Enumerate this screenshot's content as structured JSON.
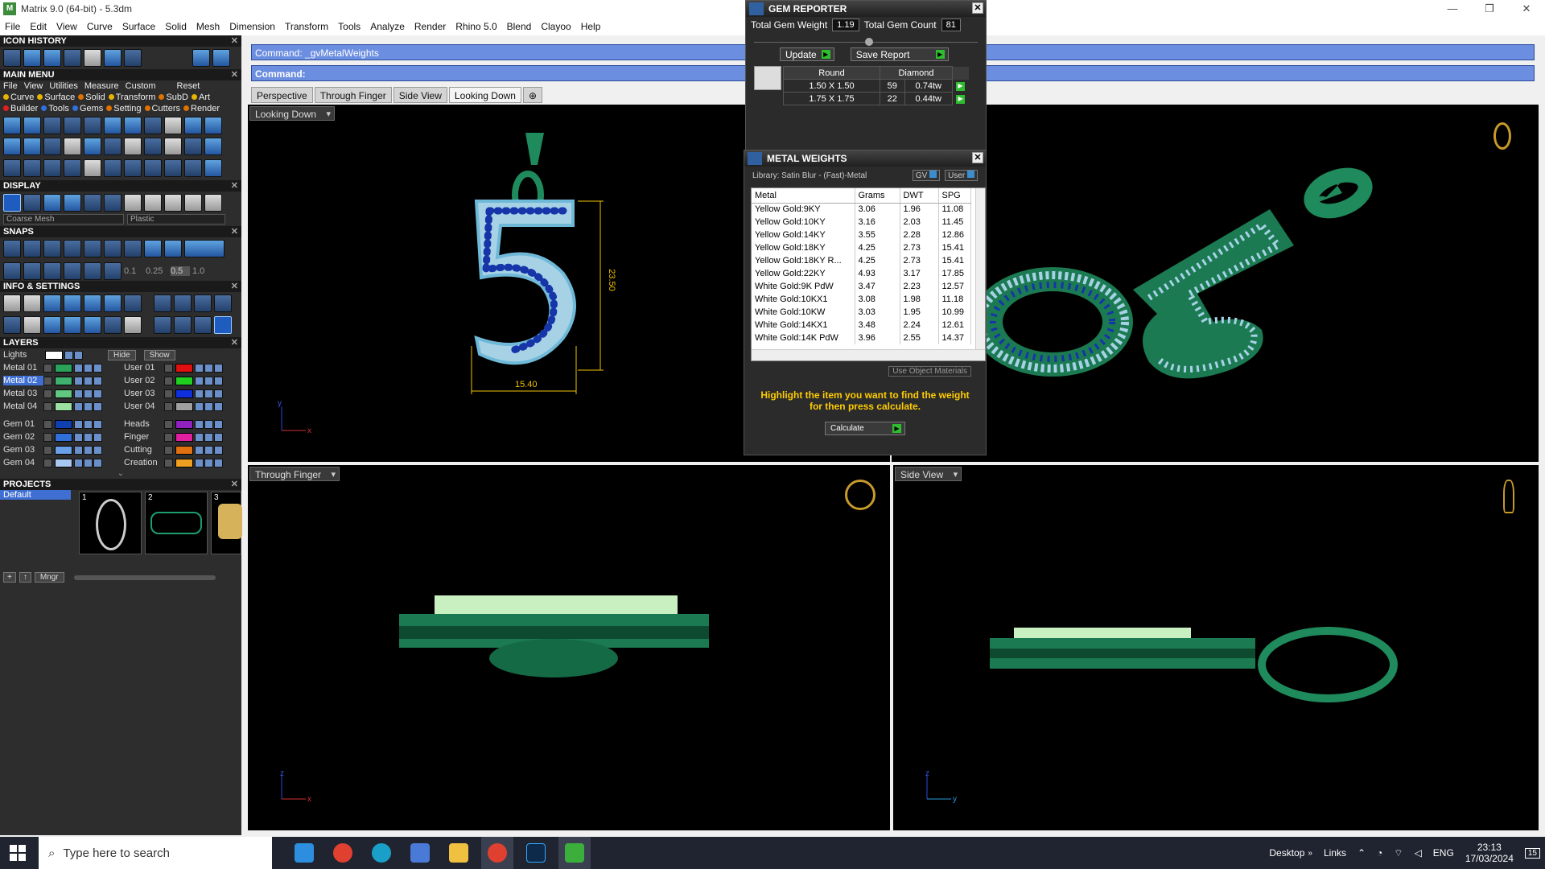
{
  "window": {
    "title": "Matrix 9.0 (64-bit) - 5.3dm",
    "controls": [
      "—",
      "❐",
      "✕"
    ]
  },
  "menubar": [
    "File",
    "Edit",
    "View",
    "Curve",
    "Surface",
    "Solid",
    "Mesh",
    "Dimension",
    "Transform",
    "Tools",
    "Analyze",
    "Render",
    "Rhino 5.0",
    "Blend",
    "Clayoo",
    "Help"
  ],
  "left_panel": {
    "icon_history": "ICON HISTORY",
    "main_menu": "MAIN MENU",
    "main_menu_row1": [
      "File",
      "View",
      "Utilities",
      "Measure",
      "Custom",
      "Reset"
    ],
    "main_menu_row2": [
      {
        "label": "Curve",
        "color": "#e8b400"
      },
      {
        "label": "Surface",
        "color": "#e8b400"
      },
      {
        "label": "Solid",
        "color": "#e07000"
      },
      {
        "label": "Transform",
        "color": "#e8b400"
      },
      {
        "label": "SubD",
        "color": "#e07000"
      },
      {
        "label": "Art",
        "color": "#e8b400"
      }
    ],
    "main_menu_row3": [
      {
        "label": "Builder",
        "color": "#e02020"
      },
      {
        "label": "Tools",
        "color": "#3070e0"
      },
      {
        "label": "Gems",
        "color": "#3070e0"
      },
      {
        "label": "Setting",
        "color": "#e07000"
      },
      {
        "label": "Cutters",
        "color": "#e07000"
      },
      {
        "label": "Render",
        "color": "#e07000"
      }
    ],
    "display": "DISPLAY",
    "display_select1": "Coarse Mesh",
    "display_select2": "Plastic",
    "snaps": "SNAPS",
    "snap_values": [
      "0.1",
      "0.25",
      "0.5",
      "1.0"
    ],
    "info_settings": "INFO & SETTINGS",
    "layers": "LAYERS",
    "lights": "Lights",
    "hide": "Hide",
    "show": "Show",
    "layers_left": [
      {
        "name": "Metal 01",
        "color": "#2aa25a",
        "selected": false
      },
      {
        "name": "Metal 02",
        "color": "#3fb070",
        "selected": true
      },
      {
        "name": "Metal 03",
        "color": "#60c880",
        "selected": false
      },
      {
        "name": "Metal 04",
        "color": "#9be0a0",
        "selected": false
      },
      {
        "name": "Gem 01",
        "color": "#1040b0",
        "selected": false
      },
      {
        "name": "Gem 02",
        "color": "#3070d8",
        "selected": false
      },
      {
        "name": "Gem 03",
        "color": "#6aa0e8",
        "selected": false
      },
      {
        "name": "Gem 04",
        "color": "#a8c8f0",
        "selected": false
      }
    ],
    "layers_right": [
      {
        "name": "User 01",
        "color": "#e01010"
      },
      {
        "name": "User 02",
        "color": "#20d020"
      },
      {
        "name": "User 03",
        "color": "#1030e0"
      },
      {
        "name": "User 04",
        "color": "#a0a0a0"
      },
      {
        "name": "Heads",
        "color": "#9020c0"
      },
      {
        "name": "Finger",
        "color": "#e020a0"
      },
      {
        "name": "Cutting",
        "color": "#e07010"
      },
      {
        "name": "Creation",
        "color": "#f0a020"
      }
    ],
    "projects": "PROJECTS",
    "project_default": "Default",
    "project_numbers": [
      "1",
      "2",
      "3"
    ],
    "mngr": "Mngr"
  },
  "command": {
    "line1": "Command: _gvMetalWeights",
    "line2": "Command:"
  },
  "tabs": [
    "Perspective",
    "Through Finger",
    "Side View",
    "Looking Down"
  ],
  "active_tab": "Looking Down",
  "viewports": {
    "top_left": "Looking Down",
    "bottom_left": "Through Finger",
    "bottom_right": "Side View"
  },
  "dimensions": {
    "height": "23.50",
    "width": "15.40"
  },
  "gem_reporter": {
    "title": "GEM REPORTER",
    "total_weight_label": "Total Gem Weight",
    "total_weight": "1.19",
    "total_count_label": "Total Gem Count",
    "total_count": "81",
    "update": "Update",
    "save_report": "Save Report",
    "headers": [
      "Round",
      "Diamond"
    ],
    "rows": [
      {
        "size": "1.50 X 1.50",
        "count": "59",
        "weight": "0.74tw"
      },
      {
        "size": "1.75 X 1.75",
        "count": "22",
        "weight": "0.44tw"
      }
    ]
  },
  "metal_weights": {
    "title": "METAL WEIGHTS",
    "library": "Library: Satin Blur - (Fast)-Metal",
    "gv": "GV",
    "user": "User",
    "headers": [
      "Metal",
      "Grams",
      "DWT",
      "SPG"
    ],
    "rows": [
      [
        "Yellow Gold:9KY",
        "3.06",
        "1.96",
        "11.08"
      ],
      [
        "Yellow Gold:10KY",
        "3.16",
        "2.03",
        "11.45"
      ],
      [
        "Yellow Gold:14KY",
        "3.55",
        "2.28",
        "12.86"
      ],
      [
        "Yellow Gold:18KY",
        "4.25",
        "2.73",
        "15.41"
      ],
      [
        "Yellow Gold:18KY R...",
        "4.25",
        "2.73",
        "15.41"
      ],
      [
        "Yellow Gold:22KY",
        "4.93",
        "3.17",
        "17.85"
      ],
      [
        "White Gold:9K PdW",
        "3.47",
        "2.23",
        "12.57"
      ],
      [
        "White Gold:10KX1",
        "3.08",
        "1.98",
        "11.18"
      ],
      [
        "White Gold:10KW",
        "3.03",
        "1.95",
        "10.99"
      ],
      [
        "White Gold:14KX1",
        "3.48",
        "2.24",
        "12.61"
      ],
      [
        "White Gold:14K PdW",
        "3.96",
        "2.55",
        "14.37"
      ]
    ],
    "use_object_materials": "Use Object Materials",
    "message": "Highlight the item you want to find the weight for then press calculate.",
    "calculate": "Calculate"
  },
  "taskbar": {
    "search_placeholder": "Type here to search",
    "desktop": "Desktop",
    "links": "Links",
    "lang": "ENG",
    "time": "23:13",
    "date": "17/03/2024",
    "notifications": "15"
  }
}
